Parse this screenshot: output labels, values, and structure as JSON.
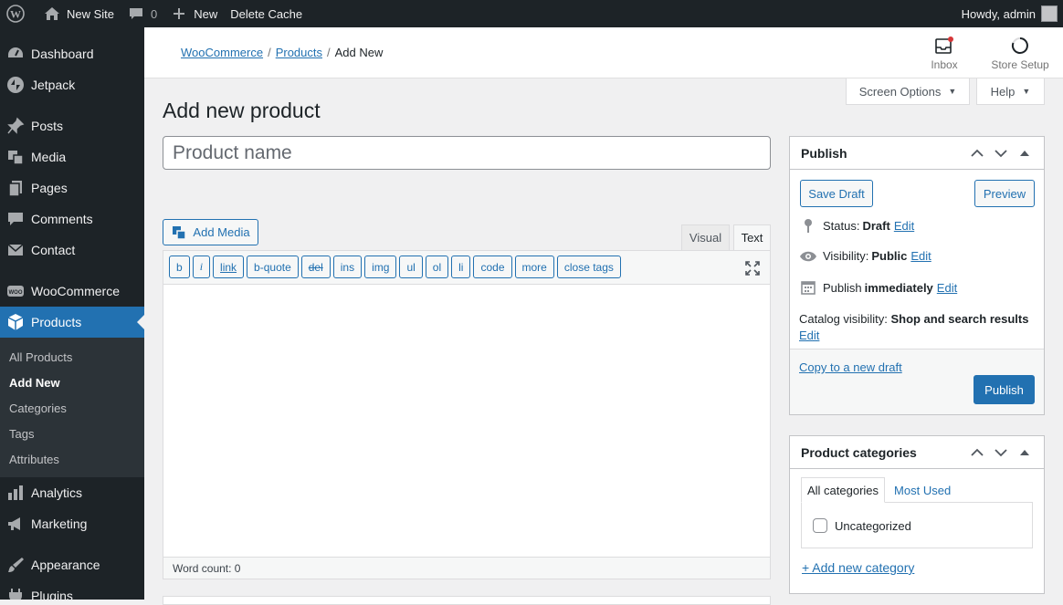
{
  "adminbar": {
    "site_name": "New Site",
    "comments_count": "0",
    "new_label": "New",
    "delete_cache": "Delete Cache",
    "howdy": "Howdy, admin"
  },
  "sidebar": {
    "items": [
      {
        "label": "Dashboard",
        "icon": "gauge-icon"
      },
      {
        "label": "Jetpack",
        "icon": "jetpack-icon"
      },
      {
        "label": "Posts",
        "icon": "pin-icon"
      },
      {
        "label": "Media",
        "icon": "media-icon"
      },
      {
        "label": "Pages",
        "icon": "pages-icon"
      },
      {
        "label": "Comments",
        "icon": "comment-icon"
      },
      {
        "label": "Contact",
        "icon": "mail-icon"
      },
      {
        "label": "WooCommerce",
        "icon": "woo-icon"
      },
      {
        "label": "Products",
        "icon": "box-icon"
      },
      {
        "label": "Analytics",
        "icon": "bar-chart-icon"
      },
      {
        "label": "Marketing",
        "icon": "megaphone-icon"
      },
      {
        "label": "Appearance",
        "icon": "brush-icon"
      },
      {
        "label": "Plugins",
        "icon": "plugin-icon"
      }
    ],
    "submenu": [
      "All Products",
      "Add New",
      "Categories",
      "Tags",
      "Attributes"
    ]
  },
  "header": {
    "breadcrumb": [
      "WooCommerce",
      "Products",
      "Add New"
    ],
    "inbox": "Inbox",
    "store_setup": "Store Setup"
  },
  "screen_options": "Screen Options",
  "help": "Help",
  "page_title": "Add new product",
  "title_placeholder": "Product name",
  "editor": {
    "add_media": "Add Media",
    "tab_visual": "Visual",
    "tab_text": "Text",
    "quicktags": [
      "b",
      "i",
      "link",
      "b-quote",
      "del",
      "ins",
      "img",
      "ul",
      "ol",
      "li",
      "code",
      "more",
      "close tags"
    ],
    "word_count": "Word count: 0"
  },
  "publish": {
    "title": "Publish",
    "save_draft": "Save Draft",
    "preview": "Preview",
    "status_label": "Status:",
    "status_value": "Draft",
    "visibility_label": "Visibility:",
    "visibility_value": "Public",
    "publish_label": "Publish",
    "publish_value": "immediately",
    "catalog_label": "Catalog visibility:",
    "catalog_value": "Shop and search results",
    "edit": "Edit",
    "copy_draft": "Copy to a new draft",
    "publish_button": "Publish"
  },
  "categories": {
    "title": "Product categories",
    "tab_all": "All categories",
    "tab_most_used": "Most Used",
    "items": [
      "Uncategorized"
    ],
    "add_new": "+ Add new category"
  },
  "colors": {
    "accent": "#2271b1",
    "adminbar": "#1d2327"
  }
}
